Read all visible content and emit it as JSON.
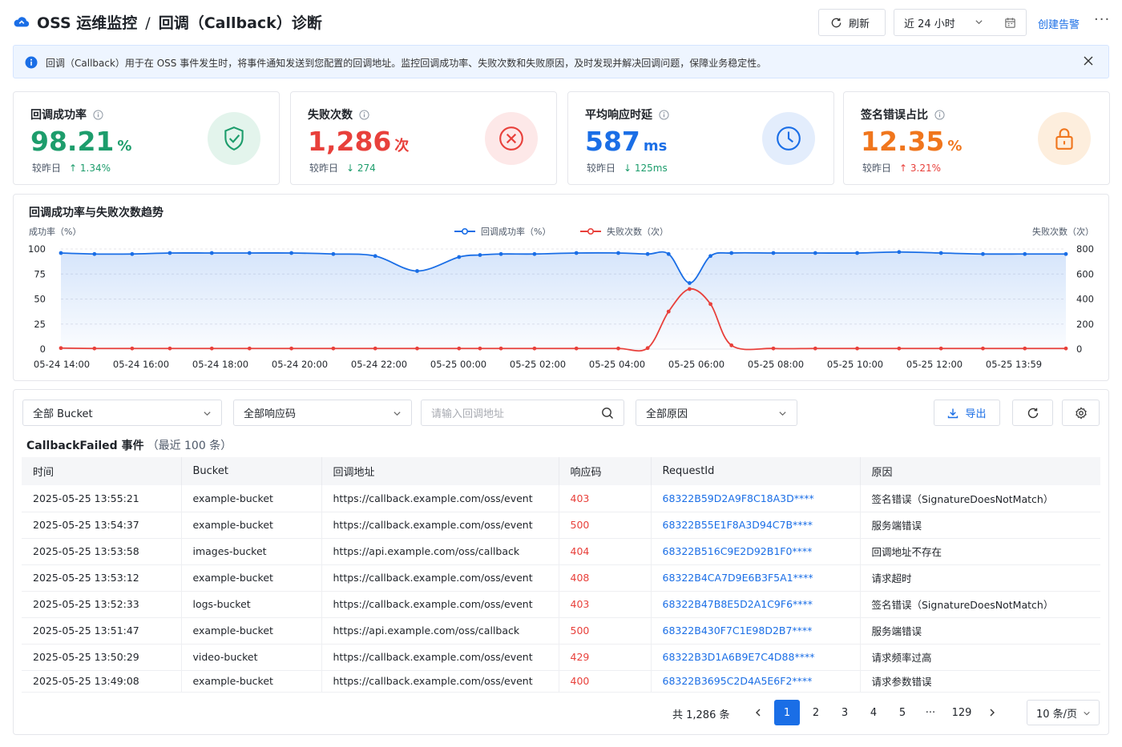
{
  "header": {
    "service": "OSS 运维监控",
    "separator": "/",
    "page": "回调（Callback）诊断",
    "refresh_label": "刷新",
    "time_range": "近 24 小时",
    "create_alert_label": "创建告警",
    "more_label": "···"
  },
  "info_bar": {
    "text": "回调（Callback）用于在 OSS 事件发生时，将事件通知发送到您配置的回调地址。监控回调成功率、失败次数和失败原因，及时发现并解决回调问题，保障业务稳定性。"
  },
  "cards": [
    {
      "label": "回调成功率",
      "value": "98.21",
      "unit": "%",
      "compare_label": "较昨日",
      "delta": "↑ 1.34%",
      "value_color": "#1d9d6c",
      "delta_color": "#1d9d6c",
      "icon": "shield-check-icon",
      "icon_bg": "#e3f4ec"
    },
    {
      "label": "失败次数",
      "value": "1,286",
      "unit": "次",
      "compare_label": "较昨日",
      "delta": "↓ 274",
      "value_color": "#e8403b",
      "delta_color": "#1d9d6c",
      "icon": "x-circle-icon",
      "icon_bg": "#fde8e8"
    },
    {
      "label": "平均响应时延",
      "value": "587",
      "unit": "ms",
      "compare_label": "较昨日",
      "delta": "↓ 125ms",
      "value_color": "#1a6ee6",
      "delta_color": "#1d9d6c",
      "icon": "clock-icon",
      "icon_bg": "#e3edfc"
    },
    {
      "label": "签名错误占比",
      "value": "12.35",
      "unit": "%",
      "compare_label": "较昨日",
      "delta": "↑ 3.21%",
      "value_color": "#f0761d",
      "delta_color": "#e8403b",
      "icon": "lock-icon",
      "icon_bg": "#fdeedd"
    }
  ],
  "chart_data": {
    "type": "line",
    "title": "回调成功率与失败次数趋势",
    "ylabel": "成功率（%）",
    "y2label": "失败次数（次）",
    "ylim": [
      0,
      100
    ],
    "y2lim": [
      0,
      800
    ],
    "yticks": [
      "100",
      "75",
      "50",
      "25",
      "0"
    ],
    "y2ticks": [
      "800",
      "600",
      "400",
      "200",
      "0"
    ],
    "xticks": [
      "05-24 14:00",
      "05-24 16:00",
      "05-24 18:00",
      "05-24 20:00",
      "05-24 22:00",
      "05-25 00:00",
      "05-25 02:00",
      "05-25 04:00",
      "05-25 06:00",
      "05-25 08:00",
      "05-25 10:00",
      "05-25 12:00",
      "05-25 13:59"
    ],
    "grid": true,
    "legend_position": "top-center",
    "x": [
      0,
      0.8,
      1.7,
      2.6,
      3.6,
      4.5,
      5.5,
      6.5,
      7.5,
      8.5,
      9.5,
      10.0,
      10.5,
      11.3,
      12.3,
      13.3,
      14.0,
      14.5,
      15.0,
      15.5,
      16.0,
      17.0,
      18.0,
      19.0,
      20.0,
      21.0,
      22.0,
      23.0,
      23.98
    ],
    "series": [
      {
        "name": "回调成功率（%）",
        "color": "#1a6ee6",
        "values": [
          96,
          95,
          95,
          96,
          96,
          96,
          96,
          95,
          93,
          78,
          92,
          94,
          95,
          95,
          96,
          96,
          95,
          95,
          66,
          93,
          96,
          96,
          96,
          96,
          97,
          96,
          95,
          95,
          95
        ]
      },
      {
        "name": "失败次数（次）",
        "color": "#e8403b",
        "values": [
          8,
          5,
          5,
          5,
          5,
          5,
          5,
          5,
          5,
          5,
          5,
          5,
          5,
          5,
          5,
          5,
          8,
          300,
          480,
          360,
          30,
          5,
          5,
          5,
          5,
          5,
          5,
          5,
          5
        ]
      }
    ]
  },
  "filters": {
    "bucket": "全部 Bucket",
    "response_code": "全部响应码",
    "url_placeholder": "请输入回调地址",
    "reason": "全部原因",
    "export_label": "导出"
  },
  "table": {
    "title": "CallbackFailed 事件",
    "subtitle": "（最近 100 条）",
    "columns": [
      "时间",
      "Bucket",
      "回调地址",
      "响应码",
      "RequestId",
      "原因"
    ],
    "rows": [
      [
        "2025-05-25 13:55:21",
        "example-bucket",
        "https://callback.example.com/oss/event",
        "403",
        "68322B59D2A9F8C18A3D****",
        "签名错误（SignatureDoesNotMatch）"
      ],
      [
        "2025-05-25 13:54:37",
        "example-bucket",
        "https://callback.example.com/oss/event",
        "500",
        "68322B55E1F8A3D94C7B****",
        "服务端错误"
      ],
      [
        "2025-05-25 13:53:58",
        "images-bucket",
        "https://api.example.com/oss/callback",
        "404",
        "68322B516C9E2D92B1F0****",
        "回调地址不存在"
      ],
      [
        "2025-05-25 13:53:12",
        "example-bucket",
        "https://callback.example.com/oss/event",
        "408",
        "68322B4CA7D9E6B3F5A1****",
        "请求超时"
      ],
      [
        "2025-05-25 13:52:33",
        "logs-bucket",
        "https://callback.example.com/oss/event",
        "403",
        "68322B47B8E5D2A1C9F6****",
        "签名错误（SignatureDoesNotMatch）"
      ],
      [
        "2025-05-25 13:51:47",
        "example-bucket",
        "https://api.example.com/oss/callback",
        "500",
        "68322B430F7C1E98D2B7****",
        "服务端错误"
      ],
      [
        "2025-05-25 13:50:29",
        "video-bucket",
        "https://callback.example.com/oss/event",
        "429",
        "68322B3D1A6B9E7C4D88****",
        "请求频率过高"
      ],
      [
        "2025-05-25 13:49:08",
        "example-bucket",
        "https://callback.example.com/oss/event",
        "400",
        "68322B3695C2D4A5E6F2****",
        "请求参数错误"
      ]
    ]
  },
  "pagination": {
    "total": "共 1,286 条",
    "pages": [
      "1",
      "2",
      "3",
      "4",
      "5",
      "···",
      "129"
    ],
    "current": "1",
    "page_size": "10 条/页"
  }
}
